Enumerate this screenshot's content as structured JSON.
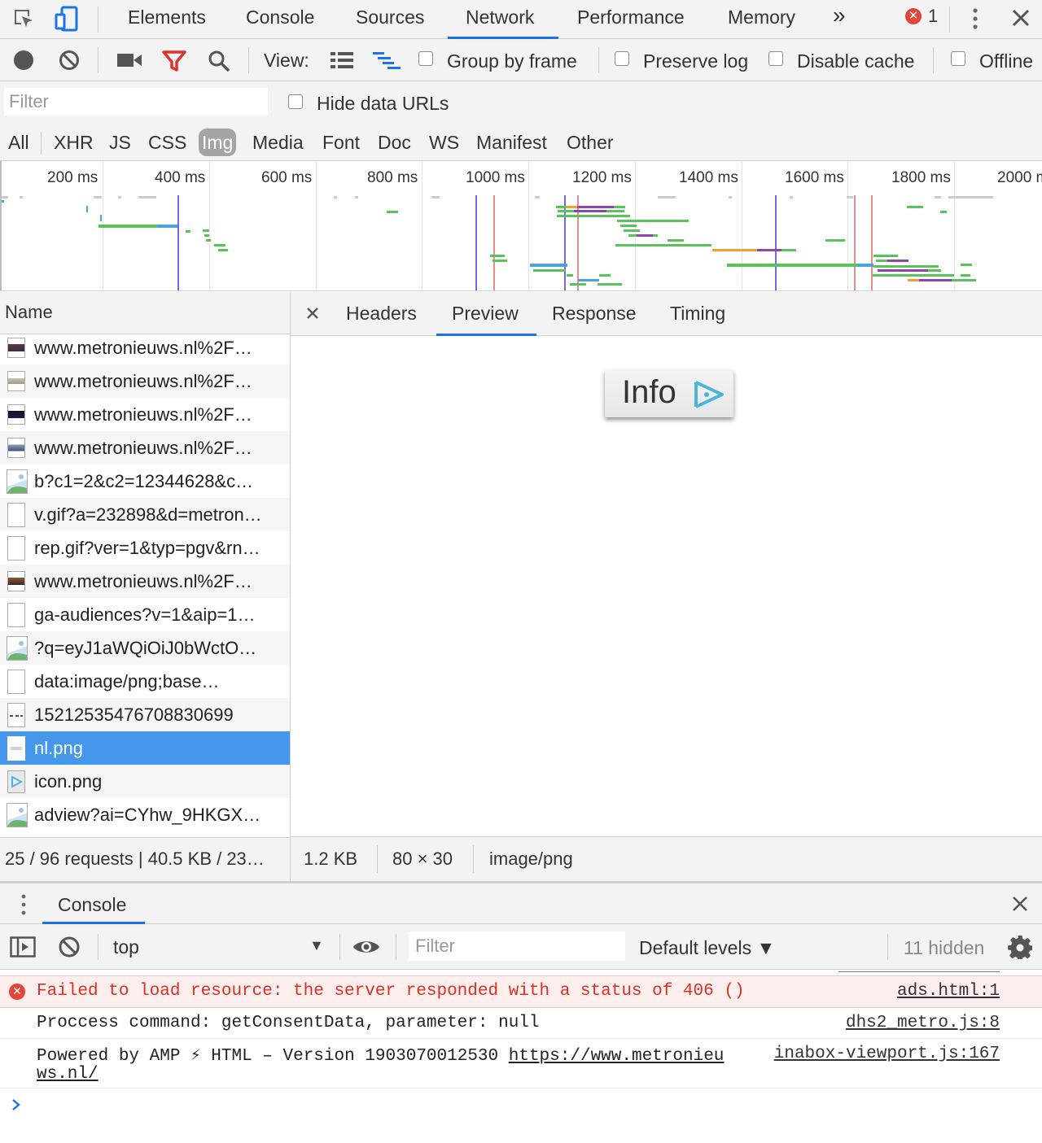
{
  "top_tabs": {
    "elements": "Elements",
    "console": "Console",
    "sources": "Sources",
    "network": "Network",
    "performance": "Performance",
    "memory": "Memory",
    "more": "»",
    "error_count": "1"
  },
  "toolbar": {
    "view_label": "View:",
    "group_by_frame": "Group by frame",
    "preserve_log": "Preserve log",
    "disable_cache": "Disable cache",
    "offline": "Offline"
  },
  "filter": {
    "placeholder": "Filter",
    "hide_data_urls": "Hide data URLs"
  },
  "type_filters": [
    "All",
    "XHR",
    "JS",
    "CSS",
    "Img",
    "Media",
    "Font",
    "Doc",
    "WS",
    "Manifest",
    "Other"
  ],
  "active_type_filter": "Img",
  "overview": {
    "ticks": [
      "200 ms",
      "400 ms",
      "600 ms",
      "800 ms",
      "1000 ms",
      "1200 ms",
      "1400 ms",
      "1600 ms",
      "1800 ms",
      "2000 ms"
    ]
  },
  "name_column": {
    "header": "Name",
    "rows": [
      {
        "name": "www.metronieuws.nl%2F…",
        "icon": "thumbnail-dark-icon"
      },
      {
        "name": "www.metronieuws.nl%2F…",
        "icon": "thumbnail-light-icon"
      },
      {
        "name": "www.metronieuws.nl%2F…",
        "icon": "thumbnail-night-icon"
      },
      {
        "name": "www.metronieuws.nl%2F…",
        "icon": "thumbnail-city-icon"
      },
      {
        "name": "b?c1=2&c2=12344628&c…",
        "icon": "broken-image-icon"
      },
      {
        "name": "v.gif?a=232898&d=metron…",
        "icon": "blank-file-icon"
      },
      {
        "name": "rep.gif?ver=1&typ=pgv&rn…",
        "icon": "blank-file-icon"
      },
      {
        "name": "www.metronieuws.nl%2F…",
        "icon": "thumbnail-people-icon"
      },
      {
        "name": "ga-audiences?v=1&aip=1…",
        "icon": "blank-file-icon"
      },
      {
        "name": "?q=eyJ1aWQiOiJ0bWctO…",
        "icon": "broken-image-icon"
      },
      {
        "name": "data:image/png;base…",
        "icon": "blank-file-icon"
      },
      {
        "name": "15212535476708830699",
        "icon": "dashed-line-icon"
      },
      {
        "name": "nl.png",
        "icon": "small-banner-icon"
      },
      {
        "name": "icon.png",
        "icon": "play-icon"
      },
      {
        "name": "adview?ai=CYhw_9HKGX…",
        "icon": "broken-image-icon"
      }
    ],
    "selected_index": 12,
    "status": "25 / 96 requests | 40.5 KB / 23…"
  },
  "preview": {
    "tabs": [
      "Headers",
      "Preview",
      "Response",
      "Timing"
    ],
    "active_tab": "Preview",
    "image_text": "Info",
    "size": "1.2 KB",
    "dimensions": "80 × 30",
    "mime": "image/png"
  },
  "drawer": {
    "tab": "Console",
    "context": "top",
    "filter_placeholder": "Filter",
    "levels": "Default levels ▼",
    "hidden": "11 hidden"
  },
  "console_messages": [
    {
      "type": "error",
      "text": "Failed to load resource: the server responded with a status of 406 ()",
      "source": "ads.html:1"
    },
    {
      "type": "log",
      "text": "Proccess command: getConsentData, parameter: null",
      "source": "dhs2_metro.js:8"
    },
    {
      "type": "log",
      "text": "Powered by AMP ⚡ HTML – Version 1903070012530 ",
      "link": "https://www.metronieu",
      "link2": "ws.nl/",
      "source": "inabox-viewport.js:167"
    }
  ],
  "colors": {
    "accent_blue": "#1a73e8",
    "selected_row": "#4597eb",
    "error_red": "#d93025",
    "error_bg": "#fdeeee"
  }
}
